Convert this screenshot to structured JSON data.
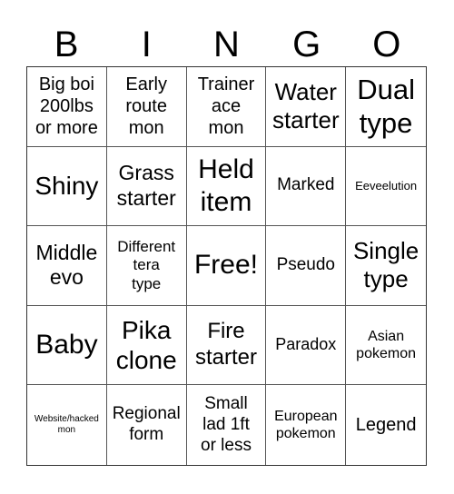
{
  "header": {
    "letters": [
      "B",
      "I",
      "N",
      "G",
      "O"
    ]
  },
  "grid": {
    "rows": [
      [
        "Big boi\n200lbs\nor more",
        "Early\nroute\nmon",
        "Trainer\nace\nmon",
        "Water\nstarter",
        "Dual\ntype"
      ],
      [
        "Shiny",
        "Grass\nstarter",
        "Held\nitem",
        "Marked",
        "Eeveelution"
      ],
      [
        "Middle\nevo",
        "Different\ntera\ntype",
        "Free!",
        "Pseudo",
        "Single\ntype"
      ],
      [
        "Baby",
        "Pika\nclone",
        "Fire\nstarter",
        "Paradox",
        "Asian\npokemon"
      ],
      [
        "Website/hacked\nmon",
        "Regional\nform",
        "Small\nlad 1ft\nor less",
        "European\npokemon",
        "Legend"
      ]
    ]
  }
}
